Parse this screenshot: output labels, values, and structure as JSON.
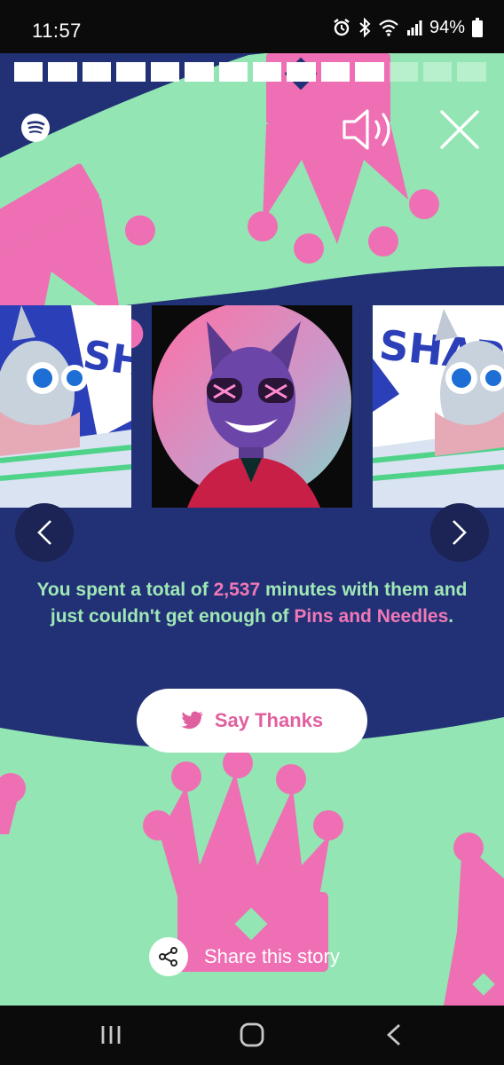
{
  "status_bar": {
    "time": "11:57",
    "battery": "94%",
    "icons": [
      "alarm-icon",
      "bluetooth-icon",
      "wifi-icon",
      "signal-icon",
      "battery-icon"
    ]
  },
  "story": {
    "progress": {
      "total": 14,
      "completed": 11
    },
    "app_logo": "spotify-logo",
    "summary": {
      "prefix": "You spent a total of ",
      "minutes": "2,537",
      "middle": " minutes with them and just couldn't get enough of ",
      "artist": "Pins and Needles",
      "suffix": "."
    },
    "say_thanks_label": "Say Thanks",
    "share_label": "Share this story",
    "artwork_side_text": "SHAPES"
  },
  "colors": {
    "background": "#223176",
    "mint": "#93e6b3",
    "pink": "#ef6fb4",
    "highlight": "#f178b6",
    "summary_text": "#9fe8b5"
  },
  "nav_bar": {
    "icons": [
      "recent-apps-icon",
      "home-icon",
      "back-icon"
    ]
  }
}
